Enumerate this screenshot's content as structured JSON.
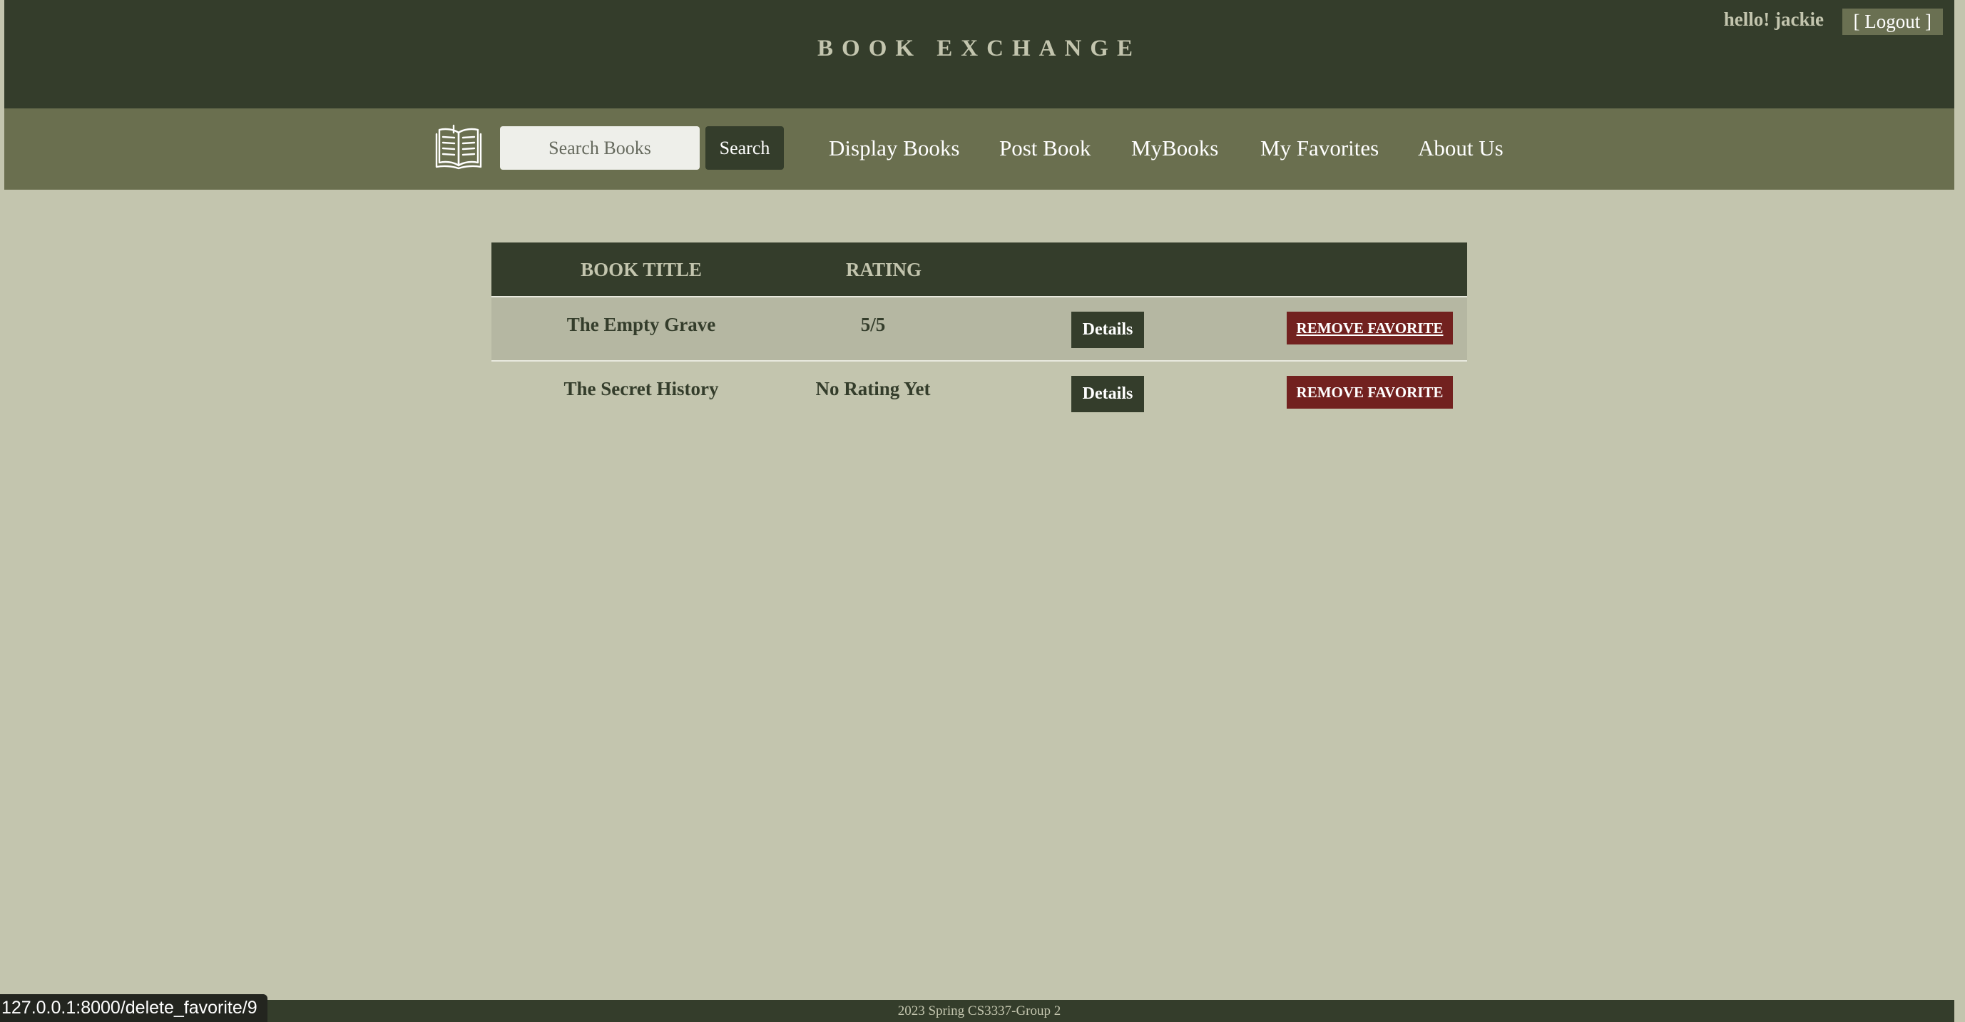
{
  "header": {
    "site_title": "BOOK EXCHANGE",
    "greeting": "hello! jackie",
    "logout_label": "[ Logout ]"
  },
  "nav": {
    "logo_icon": "open-book-icon",
    "search_placeholder": "Search Books",
    "search_label": "Search",
    "links": [
      {
        "label": "Display Books"
      },
      {
        "label": "Post Book"
      },
      {
        "label": "MyBooks"
      },
      {
        "label": "My Favorites"
      },
      {
        "label": "About Us"
      }
    ]
  },
  "favorites": {
    "columns": [
      "BOOK TITLE",
      "RATING"
    ],
    "rows": [
      {
        "title": "The Empty Grave",
        "rating": "5/5",
        "details_label": "Details",
        "remove_label": "REMOVE FAVORITE"
      },
      {
        "title": "The Secret History",
        "rating": "No Rating Yet",
        "details_label": "Details",
        "remove_label": "REMOVE FAVORITE"
      }
    ]
  },
  "footer": {
    "text": "2023 Spring CS3337-Group 2"
  },
  "status_bar": {
    "url": "127.0.0.1:8000/delete_favorite/9"
  },
  "colors": {
    "page_bg": "#c3c5ae",
    "header_bg": "#343d2b",
    "nav_bg": "#6a6f4f",
    "remove_button": "#72211f",
    "row_alt_bg": "#b5b7a2"
  }
}
